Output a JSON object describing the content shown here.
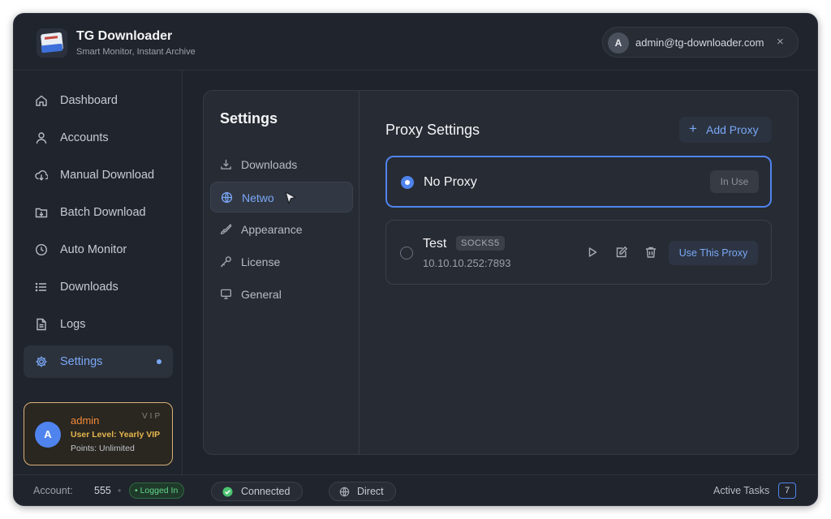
{
  "app": {
    "title": "TG Downloader",
    "subtitle": "Smart Monitor, Instant Archive"
  },
  "user": {
    "avatar_letter": "A",
    "email": "admin@tg-downloader.com",
    "close_symbol": "×"
  },
  "sidebar": {
    "items": [
      {
        "label": "Dashboard",
        "icon": "home-icon"
      },
      {
        "label": "Accounts",
        "icon": "user-icon"
      },
      {
        "label": "Manual Download",
        "icon": "cloud-download-icon"
      },
      {
        "label": "Batch Download",
        "icon": "folder-download-icon"
      },
      {
        "label": "Auto Monitor",
        "icon": "clock-icon"
      },
      {
        "label": "Downloads",
        "icon": "list-icon"
      },
      {
        "label": "Logs",
        "icon": "file-text-icon"
      },
      {
        "label": "Settings",
        "icon": "gear-icon",
        "active": true
      }
    ]
  },
  "vip": {
    "avatar_letter": "A",
    "name": "admin",
    "tag": "VIP",
    "level": "User Level:  Yearly VIP",
    "points": "Points: Unlimited"
  },
  "settings": {
    "title": "Settings",
    "nav": [
      {
        "label": "Downloads",
        "icon": "download-icon"
      },
      {
        "label": "Netwo",
        "icon": "globe-icon",
        "active": true
      },
      {
        "label": "Appearance",
        "icon": "brush-icon"
      },
      {
        "label": "License",
        "icon": "key-icon"
      },
      {
        "label": "General",
        "icon": "monitor-icon"
      }
    ]
  },
  "proxy": {
    "title": "Proxy Settings",
    "add_label": "Add Proxy",
    "add_symbol": "+",
    "no_proxy": {
      "name": "No Proxy",
      "status": "In Use"
    },
    "items": [
      {
        "name": "Test",
        "type": "SOCKS5",
        "address": "10.10.10.252:7893",
        "use_label": "Use This Proxy"
      }
    ]
  },
  "status": {
    "account_label": "Account:",
    "account_count": "555",
    "separator": "•",
    "logged_in": "• Logged In",
    "connected": "Connected",
    "direct": "Direct",
    "active_tasks_label": "Active Tasks",
    "active_tasks_count": "7"
  },
  "colors": {
    "accent": "#4f84ee",
    "accent_text": "#7aa8f7",
    "success": "#4cc471",
    "vip_border": "#d8b27a",
    "window_bg": "#1f232b"
  }
}
